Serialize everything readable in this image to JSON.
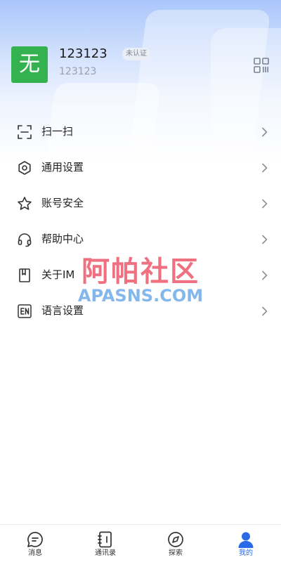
{
  "profile": {
    "avatar_text": "无",
    "avatar_color": "#34b24f",
    "name": "123123",
    "status_badge": "未认证",
    "user_id": "123123",
    "qr_icon": "qr-code-icon"
  },
  "menu": {
    "items": [
      {
        "label": "扫一扫",
        "icon": "scan-icon"
      },
      {
        "label": "通用设置",
        "icon": "hexagon-settings-icon"
      },
      {
        "label": "账号安全",
        "icon": "star-icon"
      },
      {
        "label": "帮助中心",
        "icon": "headset-icon"
      },
      {
        "label": "关于IM",
        "icon": "book-icon"
      },
      {
        "label": "语言设置",
        "icon": "en-language-icon"
      }
    ]
  },
  "watermark": {
    "cn": "阿帕社区",
    "en": "APASNS.COM"
  },
  "tabbar": {
    "active_color": "#2a6ae8",
    "items": [
      {
        "label": "消息",
        "icon": "chat-bubble-icon"
      },
      {
        "label": "通讯录",
        "icon": "contacts-book-icon"
      },
      {
        "label": "探索",
        "icon": "compass-icon"
      },
      {
        "label": "我的",
        "icon": "person-icon"
      }
    ],
    "active_index": 3
  }
}
